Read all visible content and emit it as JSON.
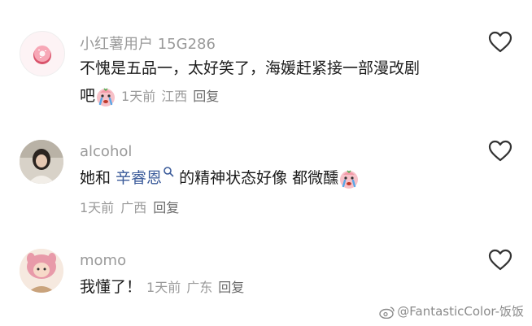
{
  "comments": [
    {
      "username": "小红薯用户 15G286",
      "text_line1": "不愧是五品一，太好笑了，海媛赶紧接一部漫改剧",
      "text_line2": "吧",
      "time": "1天前",
      "location": "江西",
      "reply": "回复"
    },
    {
      "username": "alcohol",
      "text_before": "她和 ",
      "mention": "辛睿恩",
      "text_after": " 的精神状态好像 都微醺",
      "time": "1天前",
      "location": "广西",
      "reply": "回复"
    },
    {
      "username": "momo",
      "text": "我懂了！",
      "time": "1天前",
      "location": "广东",
      "reply": "回复"
    }
  ],
  "watermark": "@FantasticColor-饭饭",
  "colors": {
    "username": "#9a9a9a",
    "text": "#1c1c1c",
    "mention": "#3b5b9a",
    "icon": "#333333"
  },
  "icons": [
    "heart-icon",
    "search-icon",
    "crying-emoji-icon",
    "weibo-icon"
  ]
}
